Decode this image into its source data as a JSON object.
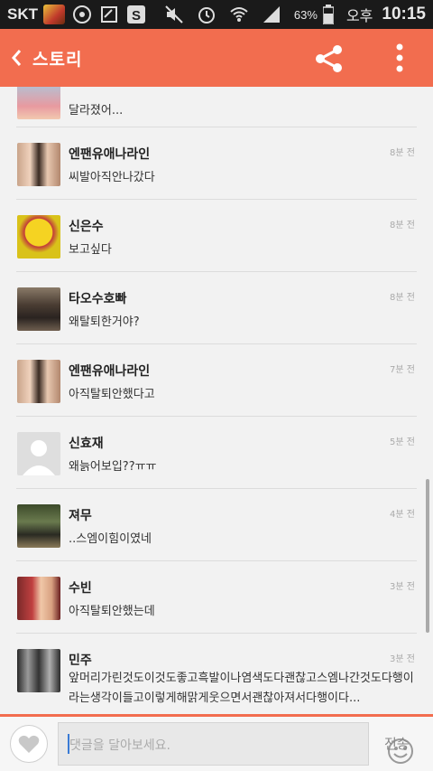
{
  "status_bar": {
    "carrier": "SKT",
    "battery_pct": "63%",
    "ampm": "오후",
    "time": "10:15"
  },
  "app_bar": {
    "back_icon": "chevron-left",
    "title": "스토리",
    "share_icon": "share",
    "more_icon": "more-vert"
  },
  "comments": [
    {
      "name": "",
      "text": "달라졌어...",
      "time": "",
      "avatar": "partial-avatar"
    },
    {
      "name": "엔팬유애나라인",
      "text": "씨발아직안나갔다",
      "time": "8분 전",
      "avatar": "two-boys-heart"
    },
    {
      "name": "신은수",
      "text": "보고싶다",
      "time": "8분 전",
      "avatar": "lisa-simpson"
    },
    {
      "name": "타오수호빠",
      "text": "왜탈퇴한거야?",
      "time": "8분 전",
      "avatar": "group-photo"
    },
    {
      "name": "엔팬유애나라인",
      "text": "아직탈퇴안했다고",
      "time": "7분 전",
      "avatar": "two-boys-heart"
    },
    {
      "name": "신효재",
      "text": "왜늙어보입??ㅠㅠ",
      "time": "5분 전",
      "avatar": "default-person"
    },
    {
      "name": "져무",
      "text": "..스엠이힘이였네",
      "time": "4분 전",
      "avatar": "stage-photo"
    },
    {
      "name": "수빈",
      "text": "아직탈퇴안했는데",
      "time": "3분 전",
      "avatar": "girl-portrait"
    },
    {
      "name": "민주",
      "text": "앞머리가린것도이것도좋고흑발이나염색도다괜찮고스엠나간것도다행이라는생각이들고이렇게해맑게웃으면서괜찮아져서다행이다...",
      "time": "3분 전",
      "avatar": "boys-collage"
    }
  ],
  "composer": {
    "like_icon": "heart",
    "placeholder": "댓글을 달아보세요.",
    "emoji_icon": "smiley",
    "send_label": "전송"
  },
  "colors": {
    "accent": "#f26d4f",
    "status_bar": "#1a1a1a",
    "background": "#f2f2f2"
  }
}
